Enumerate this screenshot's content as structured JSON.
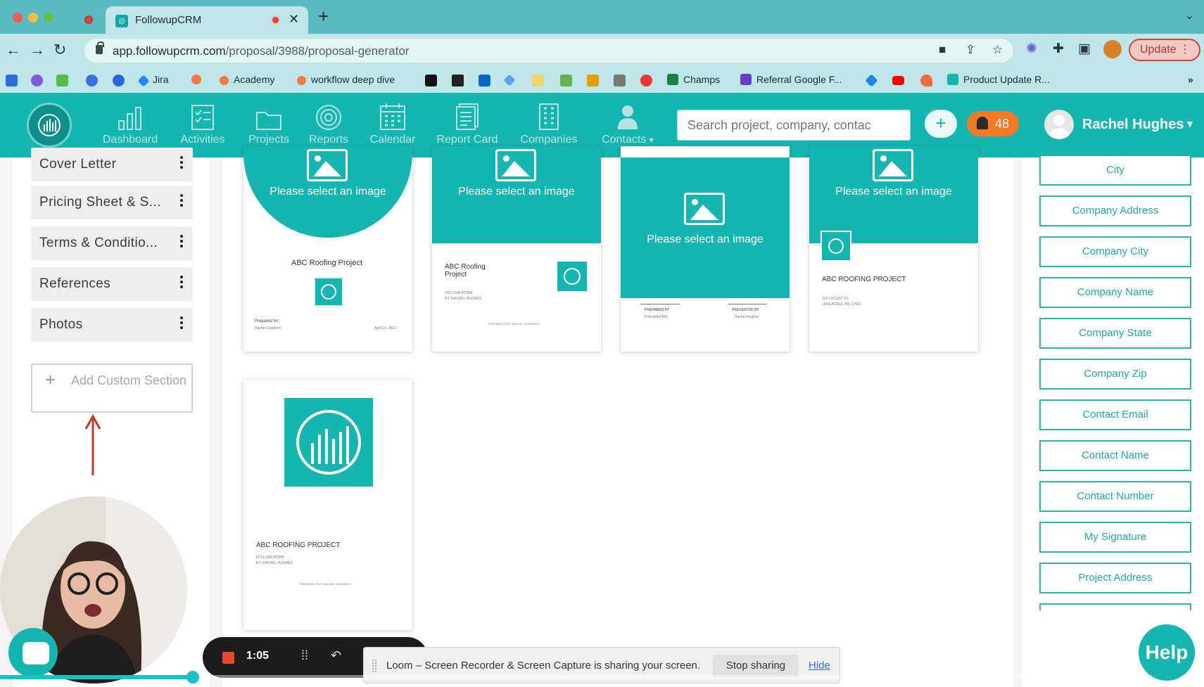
{
  "browser": {
    "tab_title": "FollowupCRM",
    "url_host": "app.followupcrm.com",
    "url_path": "/proposal/3988/proposal-generator",
    "update_label": "Update",
    "bookmarks": [
      "Jira",
      "Academy",
      "workflow deep dive",
      "Champs",
      "Referral Google F...",
      "Product Update R..."
    ]
  },
  "header": {
    "nav": [
      "Dashboard",
      "Activities",
      "Projects",
      "Reports",
      "Calendar",
      "Report Card",
      "Companies",
      "Contacts"
    ],
    "search_placeholder": "Search project, company, contac",
    "notifications": "48",
    "user_name": "Rachel Hughes"
  },
  "sections": {
    "items": [
      "Cover Letter",
      "Pricing Sheet & S...",
      "Terms & Conditio...",
      "References",
      "Photos"
    ],
    "add_label": "Add Custom Section"
  },
  "templates": {
    "select_image": "Please select an image",
    "card1": {
      "title": "ABC Roofing Project",
      "prepared_for": "Prepared for:",
      "client": "Rachel Goodrich",
      "date": "April 14, 2023"
    },
    "card2": {
      "title": "ABC Roofing Project",
      "company": "FOLLOWUPCRM",
      "by": "BY: RACHEL HUGHES",
      "footer": "PREPARED FOR: RACHEL GOODRICH"
    },
    "card3": {
      "prepared_by": "PREPARED BY",
      "prepared_by_value": "FollowUpCRM",
      "presented_by": "PRESENTED BY",
      "presented_by_value": "Rachel Hughes"
    },
    "card4": {
      "title": "ABC ROOFING PROJECT",
      "address1": "123 LOCUST ST",
      "address2": "LANCASTER, PA, 17602"
    },
    "card5": {
      "title": "ABC ROOFING PROJECT",
      "company": "FOLLOWUPCRM",
      "by": "BY: RACHEL HUGHES",
      "footer": "PREPARED FOR: RACHEL GOODRICH"
    }
  },
  "fields": [
    "City",
    "Company Address",
    "Company City",
    "Company Name",
    "Company State",
    "Company Zip",
    "Contact Email",
    "Contact Name",
    "Contact Number",
    "My Signature",
    "Project Address"
  ],
  "recorder": {
    "time": "1:05",
    "message": "Loom – Screen Recorder & Screen Capture is sharing your screen.",
    "stop_label": "Stop sharing",
    "hide_label": "Hide",
    "progress": 0.16
  },
  "help_label": "Help",
  "colors": {
    "brand": "#17b5b1",
    "notification": "#f47a28",
    "annotation_arrow": "#c0392b"
  }
}
